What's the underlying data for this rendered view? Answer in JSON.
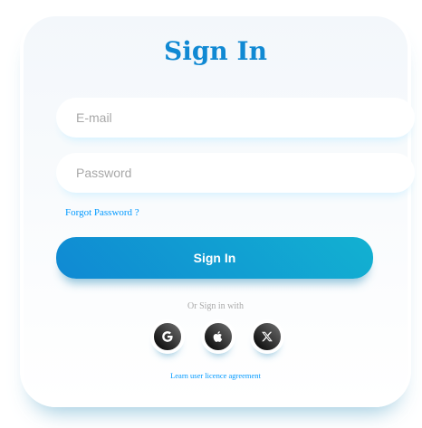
{
  "form": {
    "title": "Sign In",
    "email_placeholder": "E-mail",
    "password_placeholder": "Password",
    "forgot_label": "Forgot Password ?",
    "submit_label": "Sign In"
  },
  "social": {
    "heading": "Or Sign in with",
    "accounts": [
      {
        "icon": "google-icon"
      },
      {
        "icon": "apple-icon"
      },
      {
        "icon": "x-twitter-icon"
      }
    ]
  },
  "agreement": {
    "label": "Learn user licence agreement"
  },
  "colors": {
    "accent": "#1089d3",
    "accent_gradient_end": "#12b1d1",
    "link": "#0099ff",
    "social_button": "#000000"
  }
}
